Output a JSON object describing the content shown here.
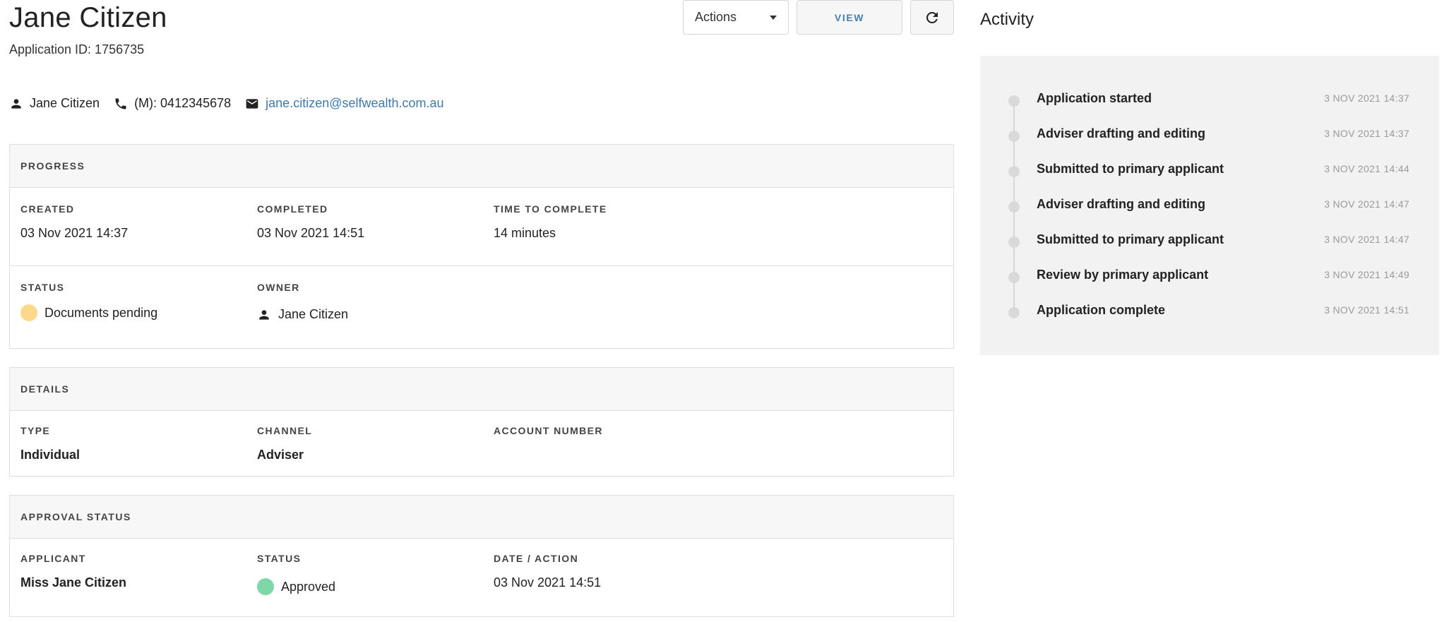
{
  "header": {
    "title": "Jane Citizen",
    "application_id": "Application ID: 1756735"
  },
  "toolbar": {
    "actions_label": "Actions",
    "view_label": "VIEW",
    "refresh_icon": "refresh-icon"
  },
  "contact": {
    "name": "Jane Citizen",
    "phone": "(M): 0412345678",
    "email": "jane.citizen@selfwealth.com.au"
  },
  "progress": {
    "heading": "PROGRESS",
    "created_label": "CREATED",
    "created_value": "03 Nov 2021 14:37",
    "completed_label": "COMPLETED",
    "completed_value": "03 Nov 2021 14:51",
    "time_label": "TIME TO COMPLETE",
    "time_value": "14 minutes",
    "status_label": "STATUS",
    "status_value": "Documents pending",
    "status_color": "#fcd98a",
    "owner_label": "OWNER",
    "owner_value": "Jane Citizen"
  },
  "details": {
    "heading": "DETAILS",
    "type_label": "TYPE",
    "type_value": "Individual",
    "channel_label": "CHANNEL",
    "channel_value": "Adviser",
    "account_label": "ACCOUNT NUMBER",
    "account_value": ""
  },
  "approval": {
    "heading": "APPROVAL STATUS",
    "applicant_label": "APPLICANT",
    "applicant_value": "Miss Jane Citizen",
    "status_label": "STATUS",
    "status_value": "Approved",
    "status_color": "#7fd6a6",
    "date_label": "DATE / ACTION",
    "date_value": "03 Nov 2021 14:51"
  },
  "activity": {
    "title": "Activity",
    "items": [
      {
        "label": "Application started",
        "time": "3 NOV 2021 14:37"
      },
      {
        "label": "Adviser drafting and editing",
        "time": "3 NOV 2021 14:37"
      },
      {
        "label": "Submitted to primary applicant",
        "time": "3 NOV 2021 14:44"
      },
      {
        "label": "Adviser drafting and editing",
        "time": "3 NOV 2021 14:47"
      },
      {
        "label": "Submitted to primary applicant",
        "time": "3 NOV 2021 14:47"
      },
      {
        "label": "Review by primary applicant",
        "time": "3 NOV 2021 14:49"
      },
      {
        "label": "Application complete",
        "time": "3 NOV 2021 14:51"
      }
    ]
  }
}
